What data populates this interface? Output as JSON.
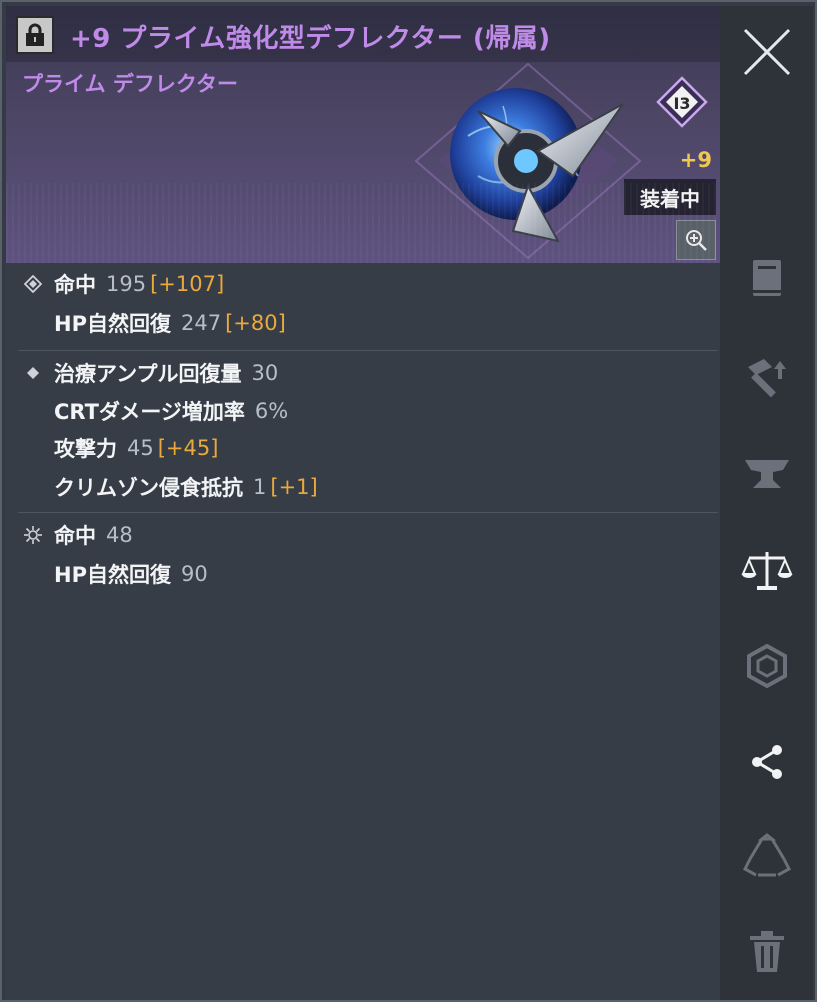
{
  "header": {
    "item_name": "+9 プライム強化型デフレクター (帰属)",
    "item_type": "プライム デフレクター",
    "grade_badge": "I3",
    "enhance_level": "+9",
    "equipped_label": "装着中"
  },
  "stats": {
    "base": [
      {
        "name": "命中",
        "value": "195",
        "bonus": "[+107]"
      },
      {
        "name": "HP自然回復",
        "value": "247",
        "bonus": "[+80]"
      }
    ],
    "additional": [
      {
        "name": "治療アンプル回復量",
        "value": "30",
        "bonus": ""
      },
      {
        "name": "CRTダメージ増加率",
        "value": "6%",
        "bonus": ""
      },
      {
        "name": "攻撃力",
        "value": "45",
        "bonus": "[+45]"
      },
      {
        "name": "クリムゾン侵食抵抗",
        "value": "1",
        "bonus": "[+1]"
      }
    ],
    "special": [
      {
        "name": "命中",
        "value": "48",
        "bonus": ""
      },
      {
        "name": "HP自然回復",
        "value": "90",
        "bonus": ""
      }
    ]
  },
  "sidebar": {
    "icons": [
      "close-icon",
      "book-icon",
      "hammer-upgrade-icon",
      "anvil-icon",
      "scales-icon",
      "hexagon-icon",
      "share-icon",
      "recycle-icon",
      "trash-icon"
    ]
  },
  "colors": {
    "title_purple": "#c08be8",
    "bonus_orange": "#e9a93c",
    "enhance_yellow": "#f0c850",
    "panel_bg": "#373d46",
    "sidebar_bg": "#2e333a"
  }
}
